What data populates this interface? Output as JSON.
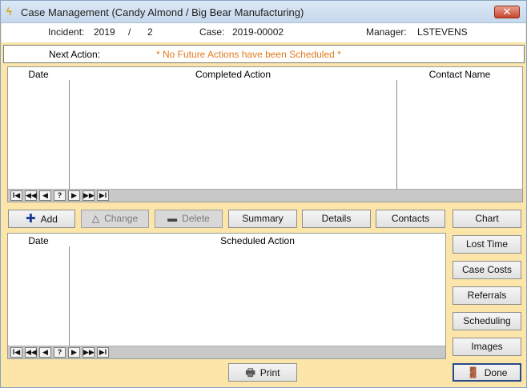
{
  "window": {
    "title": "Case Management (Candy Almond / Big Bear Manufacturing)",
    "close_glyph": "✕"
  },
  "info": {
    "incident_label": "Incident:",
    "incident_year": "2019",
    "incident_sep": "/",
    "incident_num": "2",
    "case_label": "Case:",
    "case_value": "2019-00002",
    "manager_label": "Manager:",
    "manager_value": "LSTEVENS"
  },
  "next_action": {
    "label": "Next Action:",
    "value": "* No Future Actions have been Scheduled *"
  },
  "completed_grid": {
    "columns": [
      "Date",
      "Completed Action",
      "Contact Name"
    ]
  },
  "scheduled_grid": {
    "columns": [
      "Date",
      "Scheduled Action"
    ]
  },
  "nav_buttons": [
    "I◀",
    "◀◀",
    "◀",
    "?",
    "▶",
    "▶▶",
    "▶I"
  ],
  "action_buttons": {
    "add": "Add",
    "change": "Change",
    "delete": "Delete",
    "summary": "Summary",
    "details": "Details",
    "contacts": "Contacts"
  },
  "side_buttons": {
    "chart": "Chart",
    "lost_time": "Lost Time",
    "case_costs": "Case Costs",
    "referrals": "Referrals",
    "scheduling": "Scheduling",
    "images": "Images",
    "done": "Done"
  },
  "print_button": "Print",
  "colors": {
    "window_bg": "#fbe5a8",
    "next_action_text": "#e07a1e",
    "add_icon": "#1a3a9a"
  }
}
